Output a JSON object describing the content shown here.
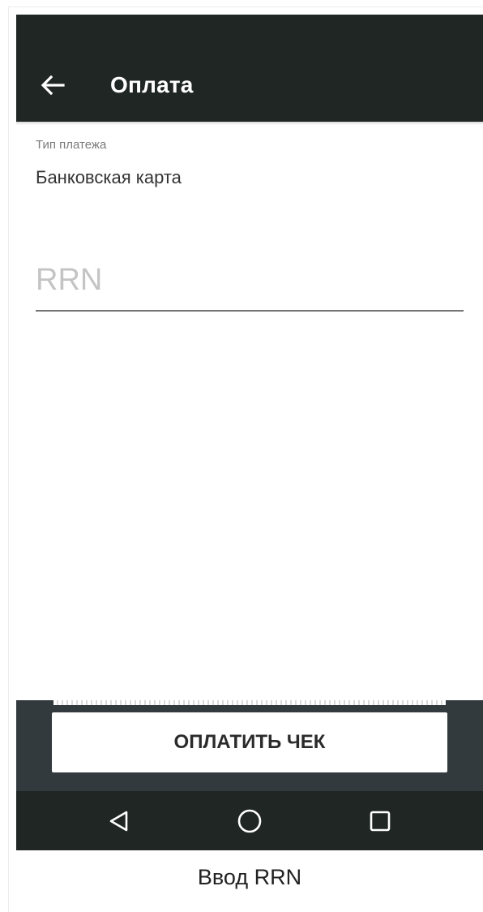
{
  "app_bar": {
    "title": "Оплата",
    "back_icon": "arrow-left-icon"
  },
  "payment_type": {
    "label": "Тип платежа",
    "value": "Банковская карта"
  },
  "rrn_field": {
    "placeholder": "RRN",
    "value": ""
  },
  "actions": {
    "pay_label": "ОПЛАТИТЬ ЧЕК"
  },
  "nav_bar": {
    "icons": [
      "back-triangle-icon",
      "home-circle-icon",
      "recents-square-icon"
    ]
  },
  "caption": "Ввод RRN",
  "colors": {
    "app_bar": "#1f2623",
    "bottom_panel": "#333a3e",
    "button_bg": "#ffffff",
    "text_primary": "#333333"
  }
}
